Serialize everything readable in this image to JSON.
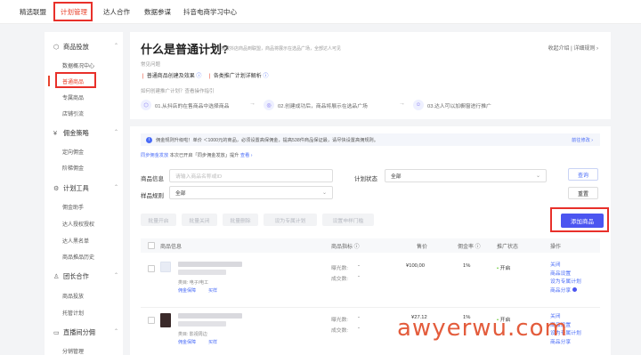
{
  "topnav": {
    "items": [
      {
        "label": "精选联盟"
      },
      {
        "label": "计划管理"
      },
      {
        "label": "达人合作"
      },
      {
        "label": "数据参谋"
      },
      {
        "label": "抖音电商学习中心"
      }
    ]
  },
  "sidebar": {
    "groups": [
      {
        "label": "商品投放",
        "items": [
          "数据概况中心",
          "普通商品",
          "专属商品",
          "店铺引流"
        ]
      },
      {
        "label": "佣金策略",
        "items": [
          "定向佣金",
          "阶梯佣金"
        ]
      },
      {
        "label": "计划工具",
        "items": [
          "佣金助手",
          "达人授权授权",
          "达人黑名单",
          "商品推品历史"
        ]
      },
      {
        "label": "团长合作",
        "items": [
          "商品投放",
          "托管计划"
        ]
      },
      {
        "label": "直播间分佣",
        "items": [
          "分销管理"
        ]
      }
    ]
  },
  "hero": {
    "title": "什么是普通计划?",
    "subtitle": "投放抖店商品到联盟，商品将展示在选品广场，全部达人可见",
    "right_links": "收起介绍 | 详细规则 ›",
    "faq_label": "常见问题",
    "faq_links": [
      "普通商品创建及效果",
      "各类推广计划详解析"
    ],
    "steps_label": "如何创建推广计划？查看操作指引",
    "steps": [
      "01.从抖店的在售商品中选择商品",
      "02.创建成功后，商品将展示在选品广场",
      "03.达人可以加橱窗进行推广"
    ]
  },
  "notice": {
    "text": "佣金规则升级啦！单价 ＜1000元的商品，必须设置高保佣金，提高538件商品保证最，请尽快设置高佣规则。",
    "right_link": "前往修改 ›"
  },
  "subnote": {
    "prefix": "同步佣金发放",
    "text": "本次已开启「同步佣金发放」提升",
    "link": "查看 ›"
  },
  "filters": {
    "goods_label": "商品信息",
    "goods_placeholder": "请输入商品名称或ID",
    "plan_status_label": "计划状态",
    "plan_status_value": "全部",
    "category_label": "样品规则",
    "category_value": "全部",
    "query_button": "查询",
    "reset_button": "重置"
  },
  "batch_actions": [
    "批量开启",
    "批量关闭",
    "批量删除",
    "设为专属计划",
    "设置申样门槛"
  ],
  "add_button": "添加商品",
  "table": {
    "headers": [
      "商品信息",
      "商品指标 ⓘ",
      "售价",
      "佣金率 ⓘ",
      "推广状态",
      "操作"
    ],
    "rows": [
      {
        "category": "类目: 电子/电工",
        "tags": [
          "佣金保障",
          "买样"
        ],
        "metric1_label": "曝光数:",
        "metric1_value": "-",
        "metric2_label": "成交数:",
        "metric2_value": "-",
        "price": "¥100,00",
        "commission": "1%",
        "status": "开启",
        "ops": [
          "关闭",
          "商品设置",
          "设为专属计划",
          "商品分享"
        ]
      },
      {
        "category": "类目: 影视周边",
        "tags": [
          "佣金保障",
          "买样"
        ],
        "metric1_label": "曝光数:",
        "metric1_value": "-",
        "metric2_label": "成交数:",
        "metric2_value": "-",
        "price": "¥27.12",
        "commission": "1%",
        "status": "开启",
        "ops": [
          "关闭",
          "商品设置",
          "设为专属计划",
          "商品分享"
        ]
      }
    ]
  },
  "watermark": "awyerwu.com",
  "colors": {
    "accent": "#e8432d",
    "primary": "#4b55f0",
    "highlight_box": "#e8302a"
  }
}
